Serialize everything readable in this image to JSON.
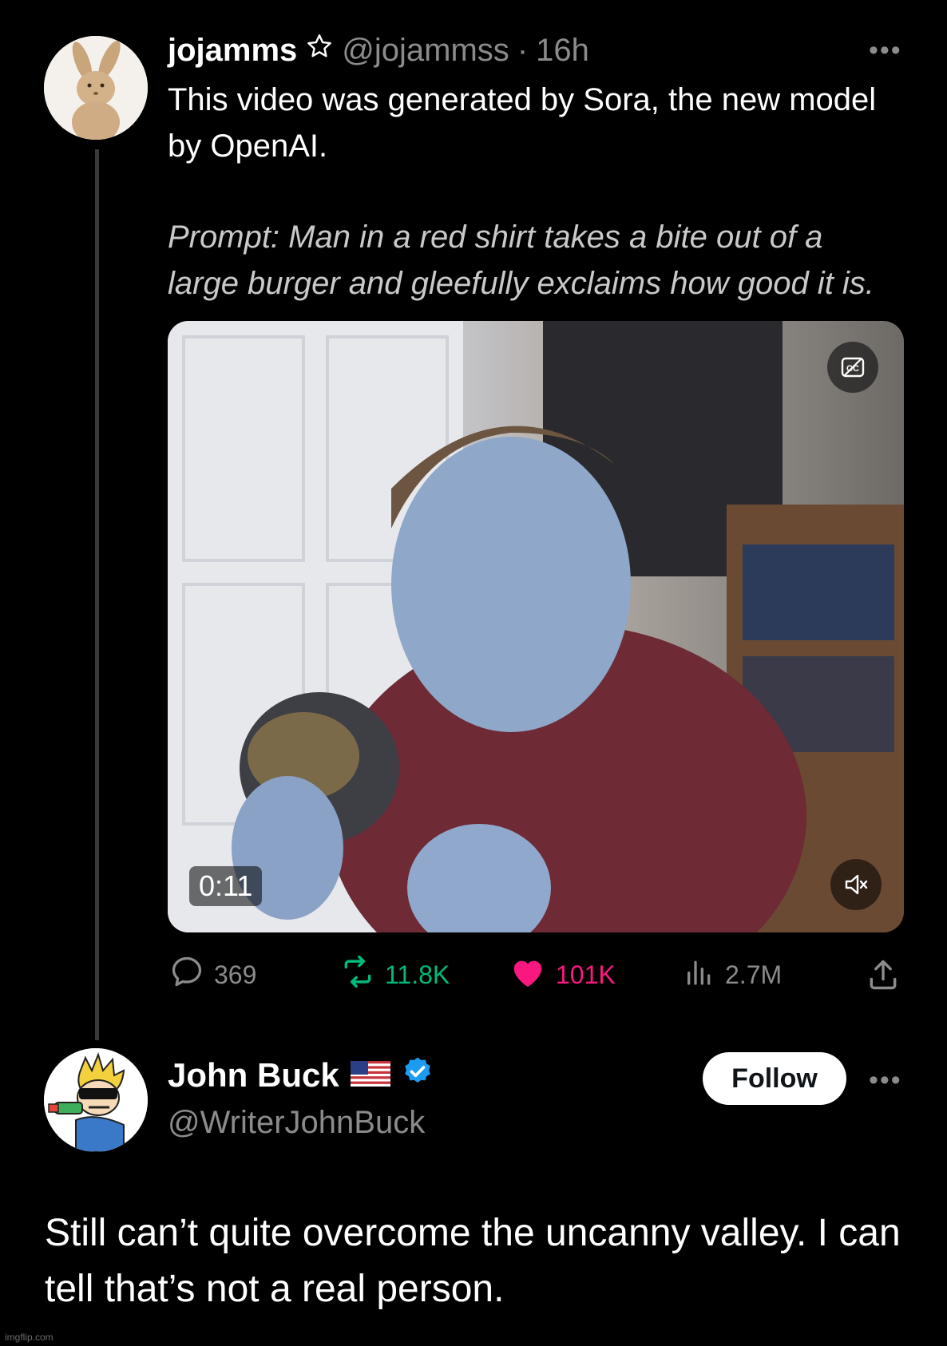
{
  "tweet1": {
    "display_name": "jojamms",
    "handle": "@jojammss",
    "separator": "·",
    "time": "16h",
    "text": "This video was generated by Sora, the new model by OpenAI.",
    "prompt": "Prompt: Man in a red shirt takes a bite out of a large burger and gleefully exclaims how good it is.",
    "video": {
      "time_label": "0:11"
    },
    "stats": {
      "replies": "369",
      "reposts": "11.8K",
      "likes": "101K",
      "views": "2.7M"
    },
    "colors": {
      "repost": "#00ba7c",
      "like": "#f91880",
      "muted": "#8b8b8b"
    }
  },
  "tweet2": {
    "display_name": "John Buck",
    "handle": "@WriterJohnBuck",
    "follow_label": "Follow",
    "text": "Still can’t quite overcome the uncanny valley. I can tell that’s not a real person.",
    "colors": {
      "verified": "#1d9bf0"
    }
  },
  "icons": [
    "star-icon",
    "more-icon",
    "captions-icon",
    "mute-icon",
    "reply-icon",
    "repost-icon",
    "like-icon",
    "views-icon",
    "share-icon",
    "flag-icon",
    "verified-badge-icon"
  ],
  "watermark": "imgflip.com"
}
